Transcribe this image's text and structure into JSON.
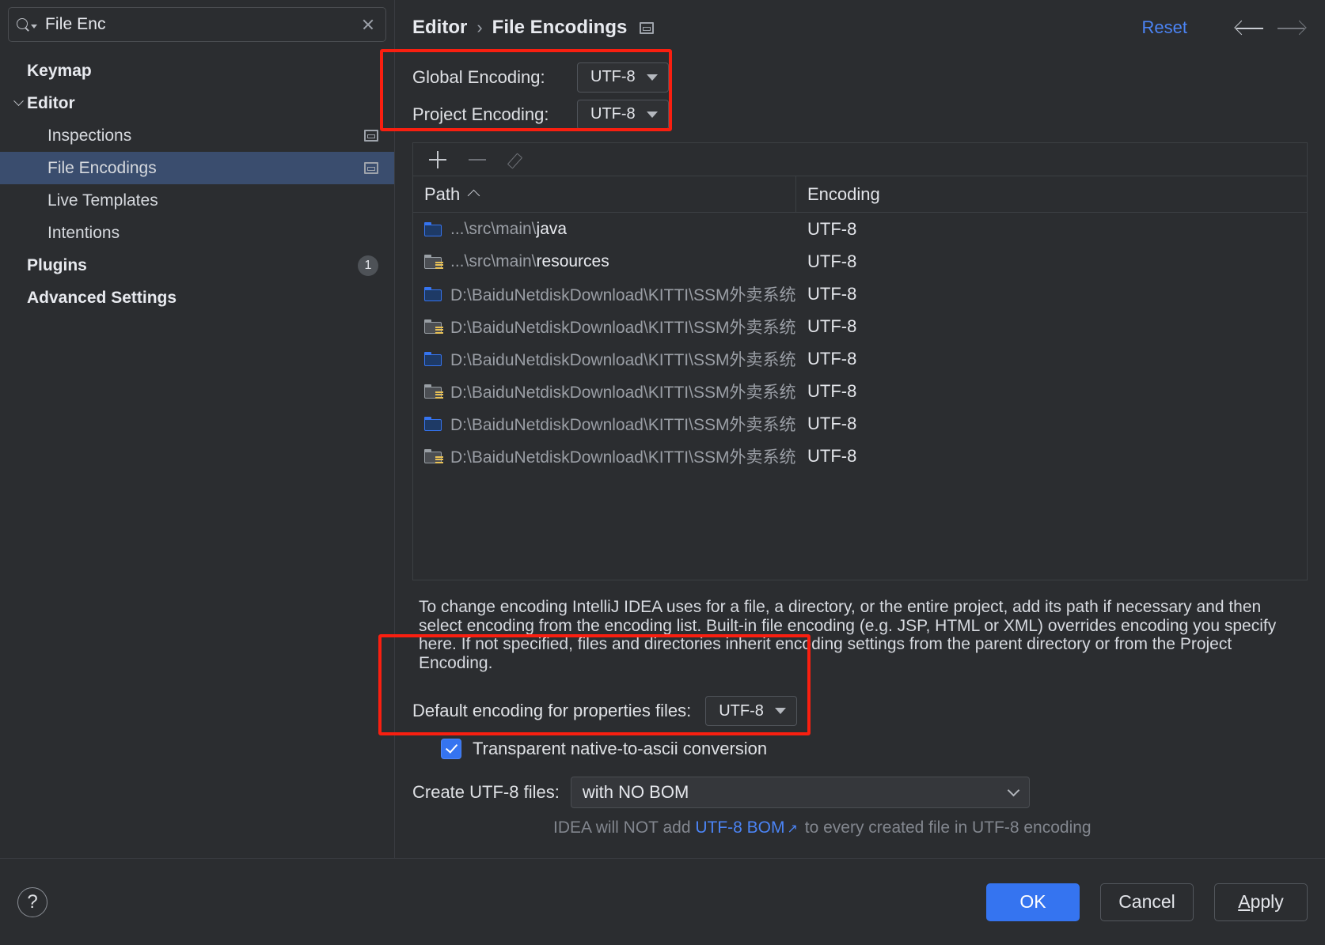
{
  "search": {
    "value": "File Enc",
    "placeholder": "Search settings"
  },
  "sidebar": {
    "items": [
      {
        "label": "Keymap",
        "level": 0,
        "arrow": false,
        "selected": false,
        "trailing": "none"
      },
      {
        "label": "Editor",
        "level": 0,
        "arrow": true,
        "selected": false,
        "trailing": "none"
      },
      {
        "label": "Inspections",
        "level": 1,
        "arrow": false,
        "selected": false,
        "trailing": "window-icon"
      },
      {
        "label": "File Encodings",
        "level": 1,
        "arrow": false,
        "selected": true,
        "trailing": "window-icon"
      },
      {
        "label": "Live Templates",
        "level": 1,
        "arrow": false,
        "selected": false,
        "trailing": "none"
      },
      {
        "label": "Intentions",
        "level": 1,
        "arrow": false,
        "selected": false,
        "trailing": "none"
      },
      {
        "label": "Plugins",
        "level": 0,
        "arrow": false,
        "selected": false,
        "trailing": "badge",
        "badge": "1"
      },
      {
        "label": "Advanced Settings",
        "level": 0,
        "arrow": false,
        "selected": false,
        "trailing": "none"
      }
    ]
  },
  "header": {
    "breadcrumb_parent": "Editor",
    "breadcrumb_sep": "›",
    "breadcrumb_current": "File Encodings",
    "reset_label": "Reset"
  },
  "encoding_settings": {
    "global_label": "Global Encoding:",
    "global_value": "UTF-8",
    "project_label": "Project Encoding:",
    "project_value": "UTF-8"
  },
  "table": {
    "columns": {
      "path": "Path",
      "encoding": "Encoding"
    },
    "sort_column": "Path",
    "sort_direction": "ascending",
    "rows": [
      {
        "icon": "folder-blue",
        "path_prefix": "...\\src\\main\\",
        "path_name": "java",
        "encoding": "UTF-8"
      },
      {
        "icon": "folder-resources",
        "path_prefix": "...\\src\\main\\",
        "path_name": "resources",
        "encoding": "UTF-8"
      },
      {
        "icon": "folder-blue",
        "path_prefix": "D:\\BaiduNetdiskDownload\\KITTI\\SSM外卖系统",
        "path_name": "",
        "encoding": "UTF-8"
      },
      {
        "icon": "folder-resources",
        "path_prefix": "D:\\BaiduNetdiskDownload\\KITTI\\SSM外卖系统",
        "path_name": "",
        "encoding": "UTF-8"
      },
      {
        "icon": "folder-blue",
        "path_prefix": "D:\\BaiduNetdiskDownload\\KITTI\\SSM外卖系统",
        "path_name": "",
        "encoding": "UTF-8"
      },
      {
        "icon": "folder-resources",
        "path_prefix": "D:\\BaiduNetdiskDownload\\KITTI\\SSM外卖系统",
        "path_name": "",
        "encoding": "UTF-8"
      },
      {
        "icon": "folder-blue",
        "path_prefix": "D:\\BaiduNetdiskDownload\\KITTI\\SSM外卖系统",
        "path_name": "",
        "encoding": "UTF-8"
      },
      {
        "icon": "folder-resources",
        "path_prefix": "D:\\BaiduNetdiskDownload\\KITTI\\SSM外卖系统",
        "path_name": "",
        "encoding": "UTF-8"
      }
    ]
  },
  "toolbar": {
    "add": "+",
    "remove": "−",
    "edit": "edit"
  },
  "description": "To change encoding IntelliJ IDEA uses for a file, a directory, or the entire project, add its path if necessary and then select encoding from the encoding list. Built-in file encoding (e.g. JSP, HTML or XML) overrides encoding you specify here. If not specified, files and directories inherit encoding settings from the parent directory or from the Project Encoding.",
  "properties": {
    "default_encoding_label": "Default encoding for properties files:",
    "default_encoding_value": "UTF-8",
    "transparent_label": "Transparent native-to-ascii conversion",
    "transparent_checked": true
  },
  "create_files": {
    "label": "Create UTF-8 files:",
    "value": "with NO BOM",
    "hint_prefix": "IDEA will NOT add ",
    "hint_link": "UTF-8 BOM",
    "hint_suffix": " to every created file in UTF-8 encoding"
  },
  "footer": {
    "help": "?",
    "ok": "OK",
    "cancel": "Cancel",
    "apply_mnemonic": "A",
    "apply_rest": "pply"
  },
  "colors": {
    "accent_blue": "#3574f0",
    "link_blue": "#4b84f5",
    "selection_blue": "#3a4d6e",
    "highlight_red": "#f91f10",
    "background": "#2b2d30"
  }
}
